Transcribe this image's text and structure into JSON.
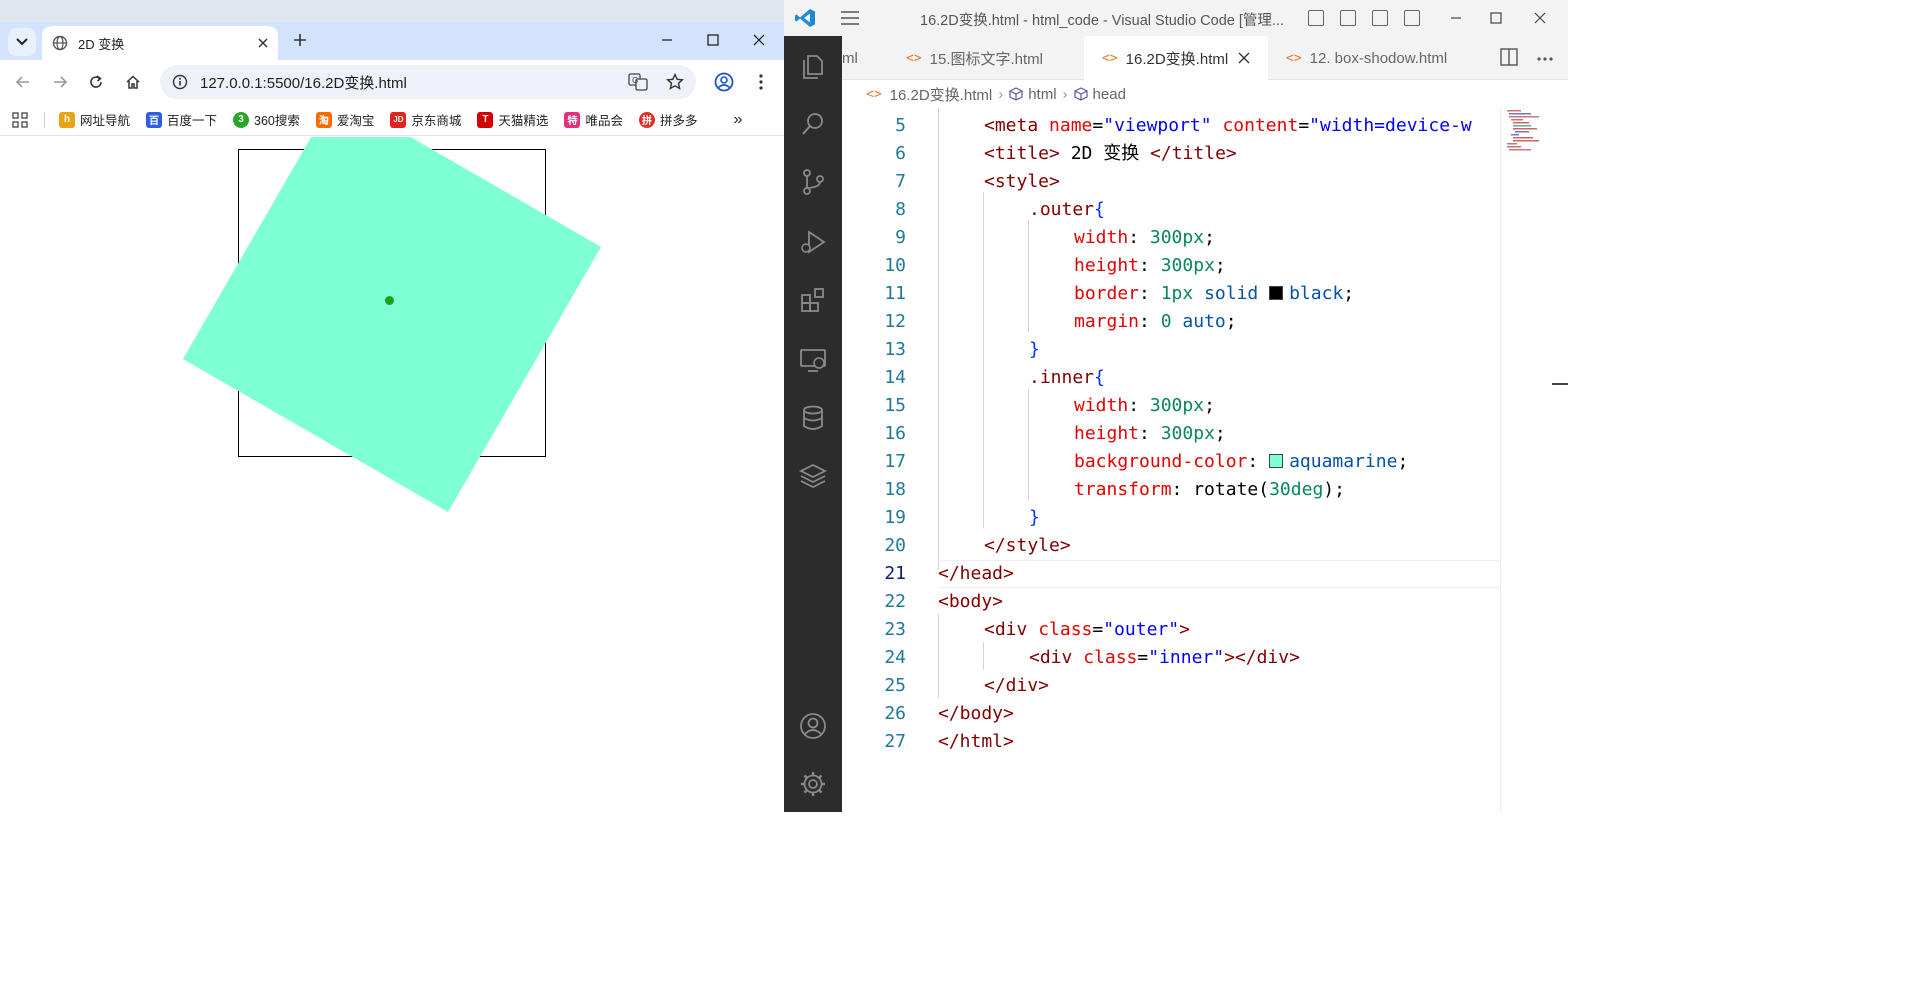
{
  "browser": {
    "tab_title": "2D 变换",
    "url": "127.0.0.1:5500/16.2D变换.html",
    "bookmarks": [
      {
        "label": "网址导航",
        "color": "#e8a317",
        "glyph": "h"
      },
      {
        "label": "百度一下",
        "color": "#2f5fe0",
        "glyph": "百"
      },
      {
        "label": "360搜索",
        "color": "#2aa52a",
        "glyph": "3"
      },
      {
        "label": "爱淘宝",
        "color": "#ff6a00",
        "glyph": "淘"
      },
      {
        "label": "京东商城",
        "color": "#e1251b",
        "glyph": "JD"
      },
      {
        "label": "天猫精选",
        "color": "#d00000",
        "glyph": "T"
      },
      {
        "label": "唯品会",
        "color": "#e5307c",
        "glyph": "特"
      },
      {
        "label": "拼多多",
        "color": "#e02e24",
        "glyph": "拼"
      }
    ],
    "more_bookmarks": "»",
    "demo_colors": {
      "inner": "#7fffd4",
      "border": "#000000"
    }
  },
  "vscode": {
    "window_title": "16.2D变换.html - html_code - Visual Studio Code [管理...",
    "tabs": [
      {
        "label": "ml",
        "partial": true
      },
      {
        "label": "15.图标文字.html"
      },
      {
        "label": "16.2D变换.html",
        "active": true
      },
      {
        "label": "12. box-shodow.html"
      }
    ],
    "breadcrumb": [
      "16.2D变换.html",
      "html",
      "head"
    ],
    "code_lines": [
      {
        "n": "5"
      },
      {
        "n": "6"
      },
      {
        "n": "7"
      },
      {
        "n": "8"
      },
      {
        "n": "9"
      },
      {
        "n": "10"
      },
      {
        "n": "11"
      },
      {
        "n": "12"
      },
      {
        "n": "13"
      },
      {
        "n": "14"
      },
      {
        "n": "15"
      },
      {
        "n": "16"
      },
      {
        "n": "17"
      },
      {
        "n": "18"
      },
      {
        "n": "19"
      },
      {
        "n": "20"
      },
      {
        "n": "21"
      },
      {
        "n": "22"
      },
      {
        "n": "23"
      },
      {
        "n": "24"
      },
      {
        "n": "25"
      },
      {
        "n": "26"
      },
      {
        "n": "27"
      }
    ],
    "current_line": "21",
    "code": {
      "l5_a": "<meta ",
      "l5_b": "name",
      "l5_c": "=",
      "l5_d": "\"viewport\"",
      "l5_e": " content",
      "l5_f": "=",
      "l5_g": "\"width=device-w",
      "l6_a": "<title>",
      "l6_b": " 2D 变换 ",
      "l6_c": "</title>",
      "l7": "<style>",
      "l8_a": ".outer",
      "l8_b": "{",
      "l9_a": "width",
      "l9_b": ": ",
      "l9_c": "300px",
      "l9_d": ";",
      "l10_a": "height",
      "l10_b": ": ",
      "l10_c": "300px",
      "l10_d": ";",
      "l11_a": "border",
      "l11_b": ": ",
      "l11_c": "1px",
      "l11_d": " solid ",
      "l11_e": "black",
      "l11_f": ";",
      "l12_a": "margin",
      "l12_b": ": ",
      "l12_c": "0",
      "l12_d": " auto",
      "l12_e": ";",
      "l13": "}",
      "l14_a": ".inner",
      "l14_b": "{",
      "l15_a": "width",
      "l15_b": ": ",
      "l15_c": "300px",
      "l15_d": ";",
      "l16_a": "height",
      "l16_b": ": ",
      "l16_c": "300px",
      "l16_d": ";",
      "l17_a": "background-color",
      "l17_b": ": ",
      "l17_c": "aquamarine",
      "l17_d": ";",
      "l18_a": "transform",
      "l18_b": ": rotate(",
      "l18_c": "30deg",
      "l18_d": ");",
      "l19": "}",
      "l20": "</style>",
      "l21": "</head>",
      "l22": "<body>",
      "l23_a": "<div ",
      "l23_b": "class",
      "l23_c": "=",
      "l23_d": "\"outer\"",
      "l23_e": ">",
      "l24_a": "<div ",
      "l24_b": "class",
      "l24_c": "=",
      "l24_d": "\"inner\"",
      "l24_e": "></div>",
      "l25": "</div>",
      "l26": "</body>",
      "l27": "</html>"
    }
  }
}
